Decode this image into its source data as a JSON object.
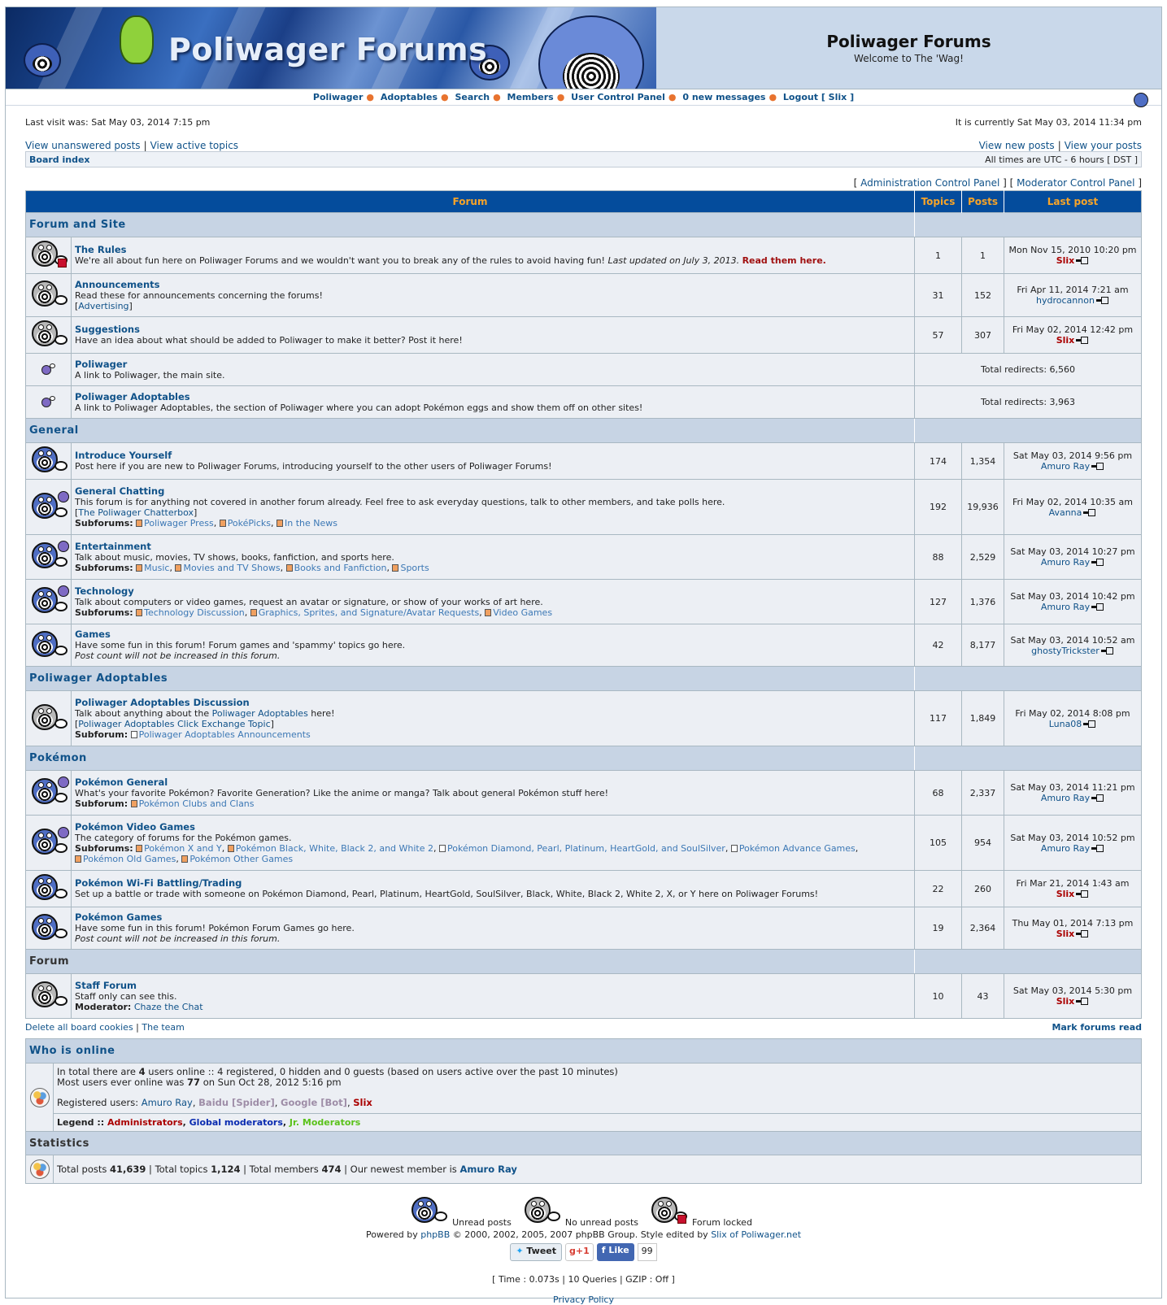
{
  "header": {
    "banner_title": "Poliwager Forums",
    "site_name": "Poliwager Forums",
    "site_desc": "Welcome to The 'Wag!"
  },
  "nav": {
    "items": [
      "Poliwager",
      "Adoptables",
      "Search",
      "Members",
      "User Control Panel",
      "0 new messages",
      "Logout [ Slix ]"
    ]
  },
  "info": {
    "last_visit": "Last visit was: Sat May 03, 2014 7:15 pm",
    "current_time": "It is currently Sat May 03, 2014 11:34 pm",
    "unanswered": "View unanswered posts",
    "active": "View active topics",
    "new_posts": "View new posts",
    "your_posts": "View your posts",
    "board_index": "Board index",
    "timezone": "All times are UTC - 6 hours [ DST ]",
    "acp": "Administration Control Panel",
    "mcp": "Moderator Control Panel"
  },
  "table_headers": {
    "forum": "Forum",
    "topics": "Topics",
    "posts": "Posts",
    "last_post": "Last post"
  },
  "categories": {
    "c1": "Forum and Site",
    "c2": "General",
    "c3": "Poliwager Adoptables",
    "c4": "Pokémon",
    "c5": "Forum"
  },
  "forums": {
    "rules": {
      "title": "The Rules",
      "desc": "We're all about fun here on Poliwager Forums and we wouldn't want you to break any of the rules to avoid having fun! ",
      "desc_italic": "Last updated on July 3, 2013.",
      "desc_strong": "Read them here.",
      "topics": "1",
      "posts": "1",
      "last_date": "Mon Nov 15, 2010 10:20 pm",
      "last_user": "Slix"
    },
    "announcements": {
      "title": "Announcements",
      "desc": "Read these for announcements concerning the forums!",
      "extra": "Advertising",
      "topics": "31",
      "posts": "152",
      "last_date": "Fri Apr 11, 2014 7:21 am",
      "last_user": "hydrocannon"
    },
    "suggestions": {
      "title": "Suggestions",
      "desc": "Have an idea about what should be added to Poliwager to make it better? Post it here!",
      "topics": "57",
      "posts": "307",
      "last_date": "Fri May 02, 2014 12:42 pm",
      "last_user": "Slix"
    },
    "poliwager": {
      "title": "Poliwager",
      "desc": "A link to Poliwager, the main site.",
      "redirects": "Total redirects: 6,560"
    },
    "poliwager_adoptables": {
      "title": "Poliwager Adoptables",
      "desc": "A link to Poliwager Adoptables, the section of Poliwager where you can adopt Pokémon eggs and show them off on other sites!",
      "redirects": "Total redirects: 3,963"
    },
    "introduce": {
      "title": "Introduce Yourself",
      "desc": "Post here if you are new to Poliwager Forums, introducing yourself to the other users of Poliwager Forums!",
      "topics": "174",
      "posts": "1,354",
      "last_date": "Sat May 03, 2014 9:56 pm",
      "last_user": "Amuro Ray"
    },
    "chatting": {
      "title": "General Chatting",
      "desc": "This forum is for anything not covered in another forum already. Feel free to ask everyday questions, talk to other members, and take polls here.",
      "extra": "The Poliwager Chatterbox",
      "sub_label": "Subforums:",
      "subs": [
        "Poliwager Press",
        "PokéPicks",
        "In the News"
      ],
      "topics": "192",
      "posts": "19,936",
      "last_date": "Fri May 02, 2014 10:35 am",
      "last_user": "Avanna"
    },
    "entertainment": {
      "title": "Entertainment",
      "desc": "Talk about music, movies, TV shows, books, fanfiction, and sports here.",
      "sub_label": "Subforums:",
      "subs": [
        "Music",
        "Movies and TV Shows",
        "Books and Fanfiction",
        "Sports"
      ],
      "topics": "88",
      "posts": "2,529",
      "last_date": "Sat May 03, 2014 10:27 pm",
      "last_user": "Amuro Ray"
    },
    "technology": {
      "title": "Technology",
      "desc": "Talk about computers or video games, request an avatar or signature, or show of your works of art here.",
      "sub_label": "Subforums:",
      "subs": [
        "Technology Discussion",
        "Graphics, Sprites, and Signature/Avatar Requests",
        "Video Games"
      ],
      "topics": "127",
      "posts": "1,376",
      "last_date": "Sat May 03, 2014 10:42 pm",
      "last_user": "Amuro Ray"
    },
    "games": {
      "title": "Games",
      "desc": "Have some fun in this forum! Forum games and 'spammy' topics go here.",
      "note": "Post count will not be increased in this forum.",
      "topics": "42",
      "posts": "8,177",
      "last_date": "Sat May 03, 2014 10:52 am",
      "last_user": "ghostyTrickster"
    },
    "adopt_discussion": {
      "title": "Poliwager Adoptables Discussion",
      "desc_a": "Talk about anything about the ",
      "desc_link": "Poliwager Adoptables",
      "desc_b": " here!",
      "extra": "Poliwager Adoptables Click Exchange Topic",
      "sub_label": "Subforum:",
      "subs": [
        "Poliwager Adoptables Announcements"
      ],
      "topics": "117",
      "posts": "1,849",
      "last_date": "Fri May 02, 2014 8:08 pm",
      "last_user": "Luna08"
    },
    "pkmn_general": {
      "title": "Pokémon General",
      "desc": "What's your favorite Pokémon? Favorite Generation? Like the anime or manga? Talk about general Pokémon stuff here!",
      "sub_label": "Subforum:",
      "subs": [
        "Pokémon Clubs and Clans"
      ],
      "topics": "68",
      "posts": "2,337",
      "last_date": "Sat May 03, 2014 11:21 pm",
      "last_user": "Amuro Ray"
    },
    "pkmn_video": {
      "title": "Pokémon Video Games",
      "desc": "The category of forums for the Pokémon games.",
      "sub_label": "Subforums:",
      "subs": [
        "Pokémon X and Y",
        "Pokémon Black, White, Black 2, and White 2",
        "Pokémon Diamond, Pearl, Platinum, HeartGold, and SoulSilver",
        "Pokémon Advance Games",
        "Pokémon Old Games",
        "Pokémon Other Games"
      ],
      "topics": "105",
      "posts": "954",
      "last_date": "Sat May 03, 2014 10:52 pm",
      "last_user": "Amuro Ray"
    },
    "wifi": {
      "title": "Pokémon Wi-Fi Battling/Trading",
      "desc": "Set up a battle or trade with someone on Pokémon Diamond, Pearl, Platinum, HeartGold, SoulSilver, Black, White, Black 2, White 2, X, or Y here on Poliwager Forums!",
      "topics": "22",
      "posts": "260",
      "last_date": "Fri Mar 21, 2014 1:43 am",
      "last_user": "Slix"
    },
    "pkmn_games": {
      "title": "Pokémon Games",
      "desc": "Have some fun in this forum! Pokémon Forum Games go here.",
      "note": "Post count will not be increased in this forum.",
      "topics": "19",
      "posts": "2,364",
      "last_date": "Thu May 01, 2014 7:13 pm",
      "last_user": "Slix"
    },
    "staff": {
      "title": "Staff Forum",
      "desc": "Staff only can see this.",
      "mod_label": "Moderator:",
      "moderator": "Chaze the Chat",
      "topics": "10",
      "posts": "43",
      "last_date": "Sat May 03, 2014 5:30 pm",
      "last_user": "Slix"
    }
  },
  "below_table": {
    "delete_cookies": "Delete all board cookies",
    "team": "The team",
    "mark_read": "Mark forums read"
  },
  "online": {
    "heading": "Who is online",
    "line1_a": "In total there are ",
    "line1_num": "4",
    "line1_b": " users online :: 4 registered, 0 hidden and 0 guests (based on users active over the past 10 minutes)",
    "line2_a": "Most users ever online was ",
    "line2_num": "77",
    "line2_b": " on Sun Oct 28, 2012 5:16 pm",
    "registered_label": "Registered users: ",
    "users": [
      "Amuro Ray",
      "Baidu [Spider]",
      "Google [Bot]",
      "Slix"
    ],
    "legend_label": "Legend :: ",
    "legend": [
      "Administrators",
      "Global moderators",
      "Jr. Moderators"
    ]
  },
  "stats": {
    "heading": "Statistics",
    "total_posts_label": "Total posts ",
    "total_posts": "41,639",
    "total_topics_label": " | Total topics ",
    "total_topics": "1,124",
    "total_members_label": " | Total members ",
    "total_members": "474",
    "newest_label": " | Our newest member is ",
    "newest": "Amuro Ray"
  },
  "footer": {
    "unread": "Unread posts",
    "no_unread": "No unread posts",
    "locked": "Forum locked",
    "powered_a": "Powered by ",
    "phpbb": "phpBB",
    "powered_b": " © 2000, 2002, 2005, 2007 phpBB Group. Style edited by ",
    "slix_of": "Slix of Poliwager.net",
    "tweet": "Tweet",
    "gplus": "g+1",
    "like": "Like",
    "like_count": "99",
    "timing": "[ Time : 0.073s | 10 Queries | GZIP : Off ]",
    "privacy": "Privacy Policy"
  },
  "colors": {
    "header_bar": "#044c9c",
    "header_text": "#f7a428",
    "category_bg": "#c7d4e4",
    "row_bg": "#eceff4",
    "link": "#105289",
    "admin": "#aa0000"
  }
}
